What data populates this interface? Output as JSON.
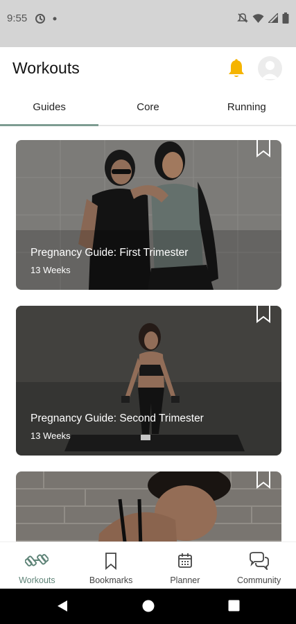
{
  "status_bar": {
    "time": "9:55"
  },
  "header": {
    "title": "Workouts"
  },
  "tabs": [
    {
      "label": "Guides",
      "active": true
    },
    {
      "label": "Core",
      "active": false
    },
    {
      "label": "Running",
      "active": false
    }
  ],
  "cards": [
    {
      "title": "Pregnancy Guide: First Trimester",
      "subtitle": "13 Weeks"
    },
    {
      "title": "Pregnancy Guide: Second Trimester",
      "subtitle": "13 Weeks"
    },
    {
      "title": "",
      "subtitle": ""
    }
  ],
  "bottom_nav": [
    {
      "label": "Workouts",
      "icon": "dumbbell-icon",
      "active": true
    },
    {
      "label": "Bookmarks",
      "icon": "bookmark-icon",
      "active": false
    },
    {
      "label": "Planner",
      "icon": "calendar-icon",
      "active": false
    },
    {
      "label": "Community",
      "icon": "chat-bubbles-icon",
      "active": false
    }
  ],
  "colors": {
    "accent": "#7d9c91",
    "bell": "#f5b400",
    "status_bar": "#d4d4d4"
  }
}
